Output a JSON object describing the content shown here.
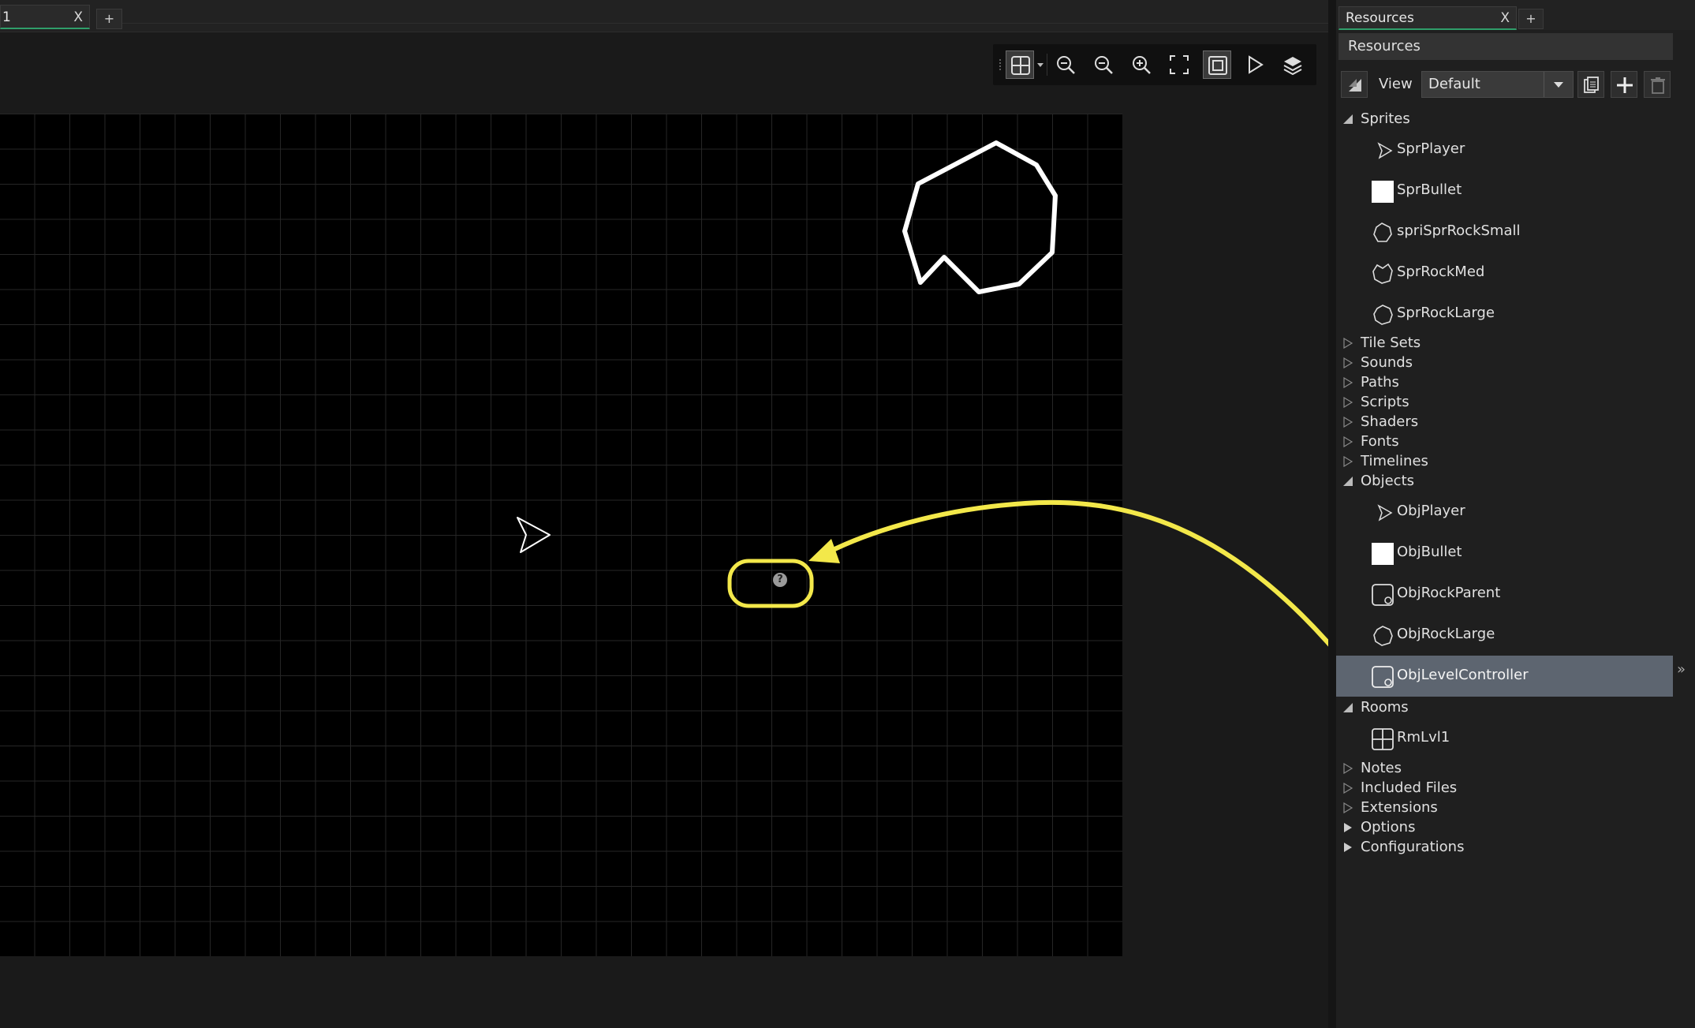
{
  "editor": {
    "room_tab_label": "1",
    "tab_close": "X",
    "add_tab": "+"
  },
  "toolbar": {
    "buttons": [
      "grid-toggle",
      "zoom-reset",
      "zoom-out",
      "zoom-in",
      "fit-view",
      "frame-room",
      "play",
      "layers"
    ]
  },
  "canvas": {
    "instance_placeholder": "?"
  },
  "resources": {
    "tab_label": "Resources",
    "tab_close": "X",
    "add_tab": "+",
    "header": "Resources",
    "view_label": "View",
    "view_value": "Default",
    "tree": {
      "sprites": {
        "label": "Sprites",
        "items": [
          "SprPlayer",
          "SprBullet",
          "spriSprRockSmall",
          "SprRockMed",
          "SprRockLarge"
        ]
      },
      "tile_sets": "Tile Sets",
      "sounds": "Sounds",
      "paths": "Paths",
      "scripts": "Scripts",
      "shaders": "Shaders",
      "fonts": "Fonts",
      "timelines": "Timelines",
      "objects": {
        "label": "Objects",
        "items": [
          "ObjPlayer",
          "ObjBullet",
          "ObjRockParent",
          "ObjRockLarge",
          "ObjLevelController"
        ]
      },
      "rooms": {
        "label": "Rooms",
        "items": [
          "RmLvl1"
        ]
      },
      "notes": "Notes",
      "included_files": "Included Files",
      "extensions": "Extensions",
      "options": "Options",
      "configurations": "Configurations"
    },
    "selected_item": "ObjLevelController",
    "expand_arrows": "»"
  },
  "colors": {
    "annotation_yellow": "#f3e84a",
    "selection": "#5d6570",
    "tab_accent": "#2f9e6a"
  }
}
